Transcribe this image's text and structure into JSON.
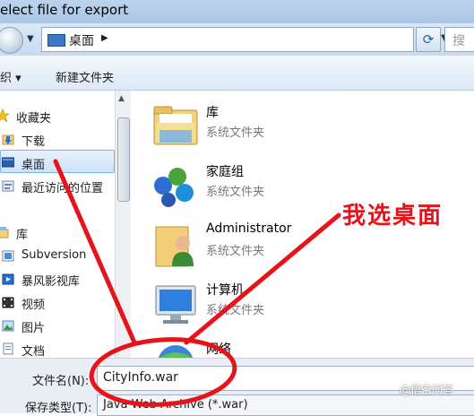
{
  "window": {
    "title": "elect file for export"
  },
  "address_bar": {
    "path_label": "桌面",
    "search_placeholder": "搜"
  },
  "toolbar": {
    "organize_label": "织 ▾",
    "new_folder_label": "新建文件夹"
  },
  "nav_pane": {
    "items": [
      {
        "label": "收藏夹",
        "icon": "star-icon"
      },
      {
        "label": "下载",
        "icon": "download-folder-icon"
      },
      {
        "label": "桌面",
        "icon": "desktop-icon",
        "selected": true
      },
      {
        "label": "最近访问的位置",
        "icon": "recent-places-icon"
      },
      {
        "label": "库",
        "icon": "library-icon"
      },
      {
        "label": "Subversion",
        "icon": "svn-folder-icon"
      },
      {
        "label": "暴风影视库",
        "icon": "video-library-icon"
      },
      {
        "label": "视频",
        "icon": "videos-icon"
      },
      {
        "label": "图片",
        "icon": "pictures-icon"
      },
      {
        "label": "文档",
        "icon": "documents-icon"
      }
    ]
  },
  "content": {
    "items": [
      {
        "name": "库",
        "type": "系统文件夹",
        "icon": "library-folder-icon"
      },
      {
        "name": "家庭组",
        "type": "系统文件夹",
        "icon": "homegroup-icon"
      },
      {
        "name": "Administrator",
        "type": "系统文件夹",
        "icon": "user-folder-icon"
      },
      {
        "name": "计算机",
        "type": "系统文件夹",
        "icon": "computer-icon"
      },
      {
        "name": "网络",
        "type": "",
        "icon": "network-icon"
      }
    ]
  },
  "bottom": {
    "filename_label": "文件名(N):",
    "filename_value": "CityInfo.war",
    "filetype_label": "保存类型(T):",
    "filetype_value": "Java Web Archive (*.war)"
  },
  "annotation": {
    "text": "我选桌面",
    "color": "#e8121b"
  },
  "watermark": {
    "text": "@悟空问答"
  }
}
